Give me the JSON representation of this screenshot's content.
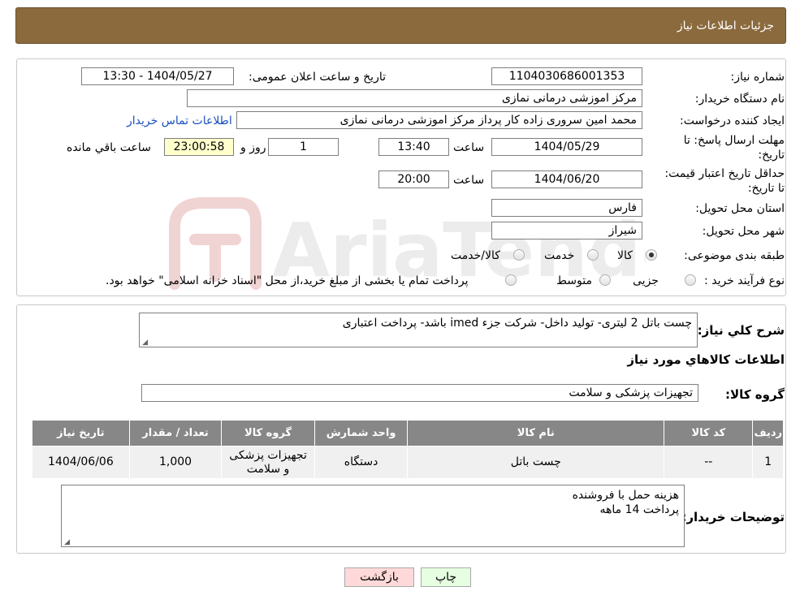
{
  "header": {
    "title": "جزئیات اطلاعات نیاز"
  },
  "form": {
    "need_number_label": "شماره نیاز:",
    "need_number": "1104030686001353",
    "announce_label": "تاریخ و ساعت اعلان عمومی:",
    "announce_value": "1404/05/27 - 13:30",
    "buyer_org_label": "نام دستگاه خریدار:",
    "buyer_org": "مرکز اموزشی درمانی نمازی",
    "creator_label": "ایجاد کننده درخواست:",
    "creator": "محمد امین سروری زاده کار پرداز مرکز اموزشی درمانی نمازی",
    "contact_link": "اطلاعات تماس خریدار",
    "deadline_label": "مهلت ارسال پاسخ: تا تاریخ:",
    "deadline_date": "1404/05/29",
    "time_word": "ساعت",
    "deadline_time": "13:40",
    "days_value": "1",
    "days_word": "روز و",
    "remaining_time": "23:00:58",
    "remaining_label": "ساعت باقي مانده",
    "validity_label": "حداقل تاریخ اعتبار قیمت: تا تاریخ:",
    "validity_date": "1404/06/20",
    "validity_time": "20:00",
    "province_label": "استان محل تحویل:",
    "province": "فارس",
    "city_label": "شهر محل تحویل:",
    "city": "شیراز",
    "category_label": "طبقه بندی موضوعی:",
    "category_options": [
      "کالا",
      "خدمت",
      "کالا/خدمت"
    ],
    "category_selected": "کالا",
    "process_label": "نوع فرآیند خرید :",
    "process_options": [
      "جزیی",
      "متوسط"
    ],
    "process_note": "پرداخت تمام یا بخشی از مبلغ خرید،از محل \"اسناد خزانه اسلامی\" خواهد بود."
  },
  "details": {
    "summary_label": "شرح کلي نياز:",
    "summary": "چست باتل 2 لیتری- تولید داخل- شرکت جزء imed باشد- پرداخت اعتباری",
    "goods_info_title": "اطلاعات کالاهاي مورد نياز",
    "goods_group_label": "گروه کالا:",
    "goods_group": "تجهیزات پزشکی و سلامت",
    "table": {
      "headers": [
        "ردیف",
        "کد کالا",
        "نام کالا",
        "واحد شمارش",
        "گروه کالا",
        "تعداد / مقدار",
        "تاریخ نیاز"
      ],
      "rows": [
        [
          "1",
          "--",
          "چست باتل",
          "دستگاه",
          "تجهیزات پزشکی و سلامت",
          "1,000",
          "1404/06/06"
        ]
      ]
    },
    "buyer_notes_label": "توضیحات خریدار:",
    "buyer_notes_line1": "هزینه حمل با فروشنده",
    "buyer_notes_line2": "پرداخت 14 ماهه"
  },
  "buttons": {
    "print": "چاپ",
    "back": "بازگشت"
  },
  "colors": {
    "header_bg": "#8b6a3d",
    "table_header_bg": "#878787",
    "back_btn_bg": "#ffd9d9",
    "print_btn_bg": "#e6ffe0"
  }
}
